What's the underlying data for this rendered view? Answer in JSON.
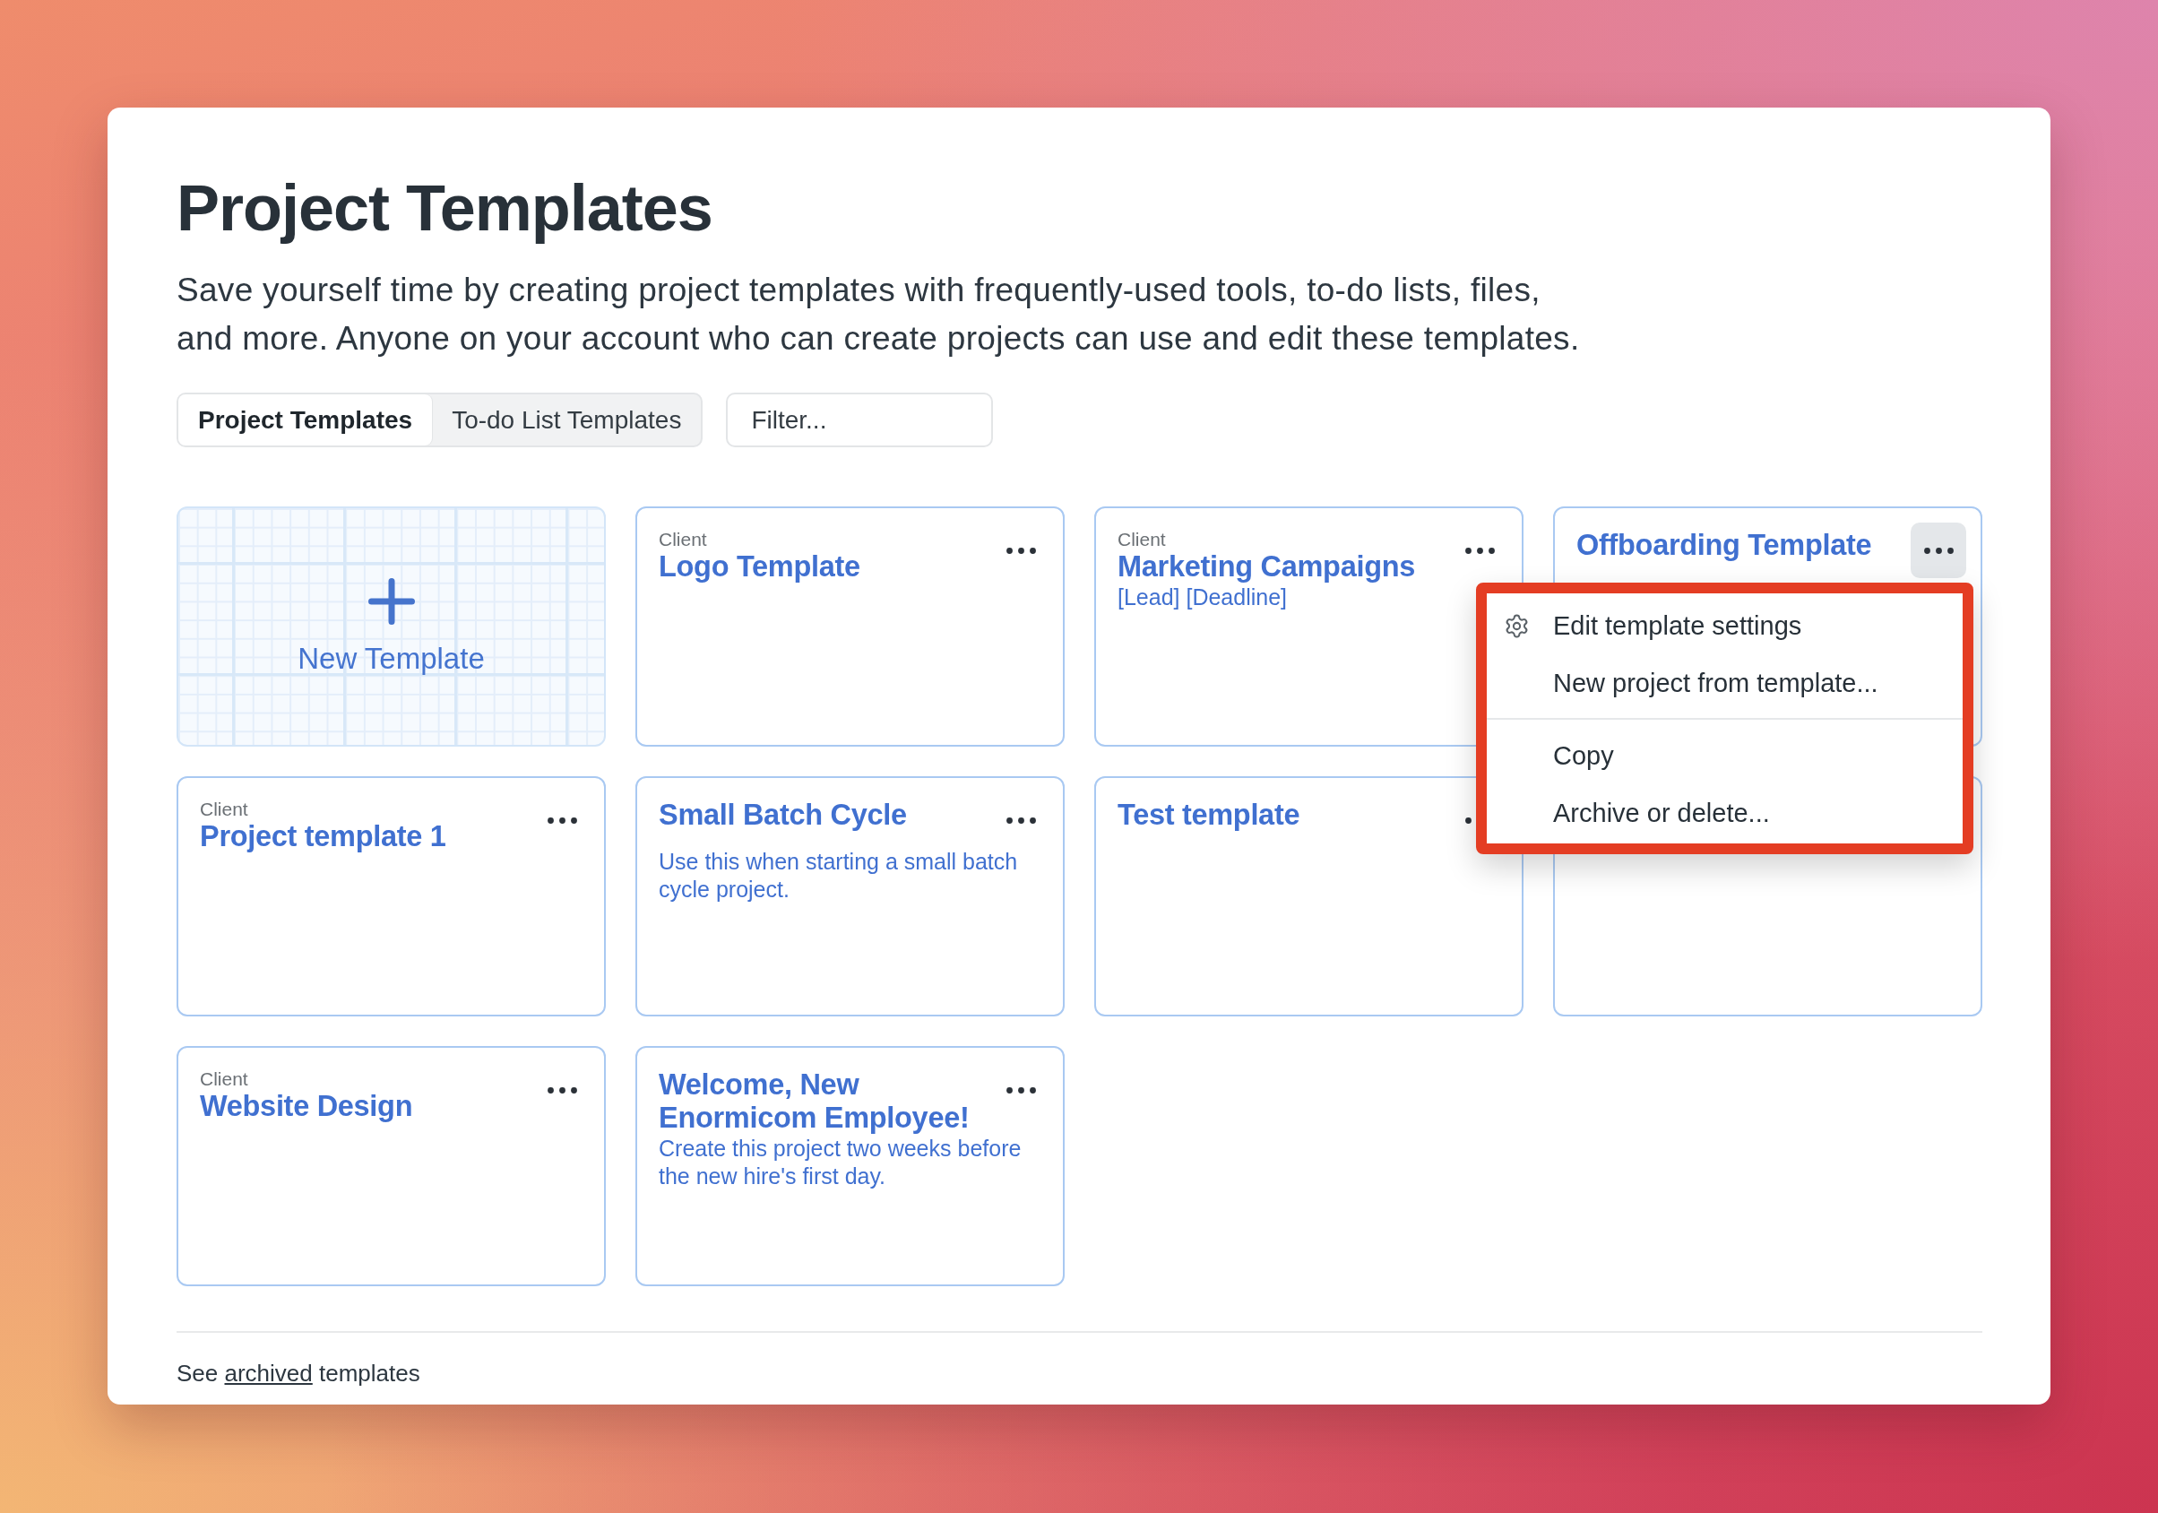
{
  "page": {
    "title": "Project Templates",
    "description": "Save yourself time by creating project templates with frequently-used tools, to-do lists, files, and more. Anyone on your account who can create projects can use and edit these templates."
  },
  "tabs": [
    {
      "label": "Project Templates",
      "selected": true
    },
    {
      "label": "To-do List Templates",
      "selected": false
    }
  ],
  "filter": {
    "placeholder": "Filter..."
  },
  "new_template": {
    "label": "New Template"
  },
  "templates": [
    {
      "client": "Client",
      "title": "Logo Template",
      "menu_open": false
    },
    {
      "client": "Client",
      "title": "Marketing Campaigns",
      "description": "[Lead] [Deadline]",
      "menu_open": false
    },
    {
      "title": "Offboarding Template",
      "menu_open": true
    },
    {
      "client": "Client",
      "title": "Project template 1",
      "menu_open": false
    },
    {
      "title": "Small Batch Cycle",
      "description": "Use this when starting a small batch cycle project.",
      "menu_open": false
    },
    {
      "title": "Test template",
      "menu_open": false
    },
    {
      "menu_open": false
    },
    {
      "client": "Client",
      "title": "Website Design",
      "menu_open": false
    },
    {
      "title": "Welcome, New Enormicom Employee!",
      "description": "Create this project two weeks before the new hire's first day.",
      "menu_open": false
    }
  ],
  "menu": {
    "highlighted": true,
    "groups": [
      {
        "items": [
          {
            "label": "Edit template settings",
            "kind": "settings"
          },
          {
            "label": "New project from template...",
            "kind": "action"
          }
        ]
      },
      {
        "items": [
          {
            "label": "Copy",
            "kind": "action"
          },
          {
            "label": "Archive or delete...",
            "kind": "action"
          }
        ]
      }
    ]
  },
  "footer": {
    "before": "See",
    "link": "archived",
    "after": "templates"
  }
}
